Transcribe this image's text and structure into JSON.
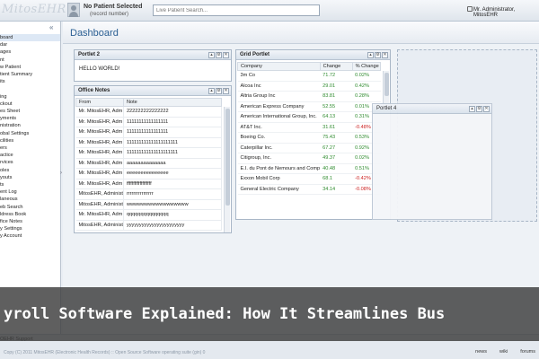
{
  "header": {
    "logo": "MitosEHR",
    "patient_name": "No Patient Selected",
    "patient_record": "(record number)",
    "search_placeholder": "Live Patient Search...",
    "user": "Mr. Administrator, MitosEHR"
  },
  "nav": {
    "collapse_glyph": "«",
    "items": [
      "board",
      "dar",
      "ages",
      "nt",
      "w Patient",
      "tient Summary",
      "its",
      "",
      "ing",
      "ckout",
      "es Sheet",
      "yments",
      "nistration",
      "obal Settings",
      "cilities",
      "ers",
      "actice",
      "rvices",
      "oles",
      "youts",
      "ts",
      "ent Log",
      "laneous",
      "eb Search",
      "ldress Book",
      "fice Notes",
      "y Settings",
      "y Account"
    ],
    "active_index": 0,
    "bottom": "OEHR Support"
  },
  "main": {
    "title": "Dashboard"
  },
  "portlet2": {
    "title": "Portlet 2",
    "body": "HELLO WORLD!"
  },
  "office_notes": {
    "title": "Office Notes",
    "columns": [
      "From",
      "Note"
    ],
    "rows": [
      [
        "Mr. MitosEHR, Adm",
        "222222222222222"
      ],
      [
        "Mr. MitosEHR, Adm",
        "11111111111111111"
      ],
      [
        "Mr. MitosEHR, Adm",
        "11111111111111111"
      ],
      [
        "Mr. MitosEHR, Adm",
        "111111111111111111111"
      ],
      [
        "Mr. MitosEHR, Adm",
        "111111111111111111111"
      ],
      [
        "Mr. MitosEHR, Adm",
        "aaaaaaaaaaaaaa"
      ],
      [
        "Mr. MitosEHR, Adm",
        "eeeeeeeeeeeeeee"
      ],
      [
        "Mr. MitosEHR, Adm",
        "fffffffffffffffffff"
      ],
      [
        "MitosEHR, Administ",
        "rrrrrrrrrrrrrrrr"
      ],
      [
        "MitosEHR, Administ",
        "wwwwwwwwwwwwwwwww"
      ],
      [
        "Mr. MitosEHR, Adm",
        "qqqqqqqqqqqqqqq"
      ],
      [
        "MitosEHR, Administ",
        "yyyyyyyyyyyyyyyyyyyyyyy"
      ]
    ]
  },
  "grid": {
    "title": "Grid Portlet",
    "columns": [
      "Company",
      "Change",
      "% Change"
    ],
    "rows": [
      [
        "3m Co",
        "71.72",
        "0.02%"
      ],
      [
        "Alcoa Inc",
        "29.01",
        "0.42%"
      ],
      [
        "Altria Group Inc",
        "83.81",
        "0.28%"
      ],
      [
        "American Express Company",
        "52.55",
        "0.01%"
      ],
      [
        "American International Group, Inc.",
        "64.13",
        "0.31%"
      ],
      [
        "AT&T Inc.",
        "31.61",
        "-0.48%"
      ],
      [
        "Boeing Co.",
        "75.43",
        "0.53%"
      ],
      [
        "Caterpillar Inc.",
        "67.27",
        "0.92%"
      ],
      [
        "Citigroup, Inc.",
        "49.37",
        "0.02%"
      ],
      [
        "E.I. du Pont de Nemours and Comp",
        "40.48",
        "0.51%"
      ],
      [
        "Exxon Mobil Corp",
        "68.1",
        "-0.42%"
      ],
      [
        "General Electric Company",
        "34.14",
        "-0.08%"
      ]
    ],
    "pos_color": "#2e8b2e",
    "neg_color": "#cc2222"
  },
  "portlet4": {
    "title": "Portlet 4"
  },
  "footer": {
    "copyright": "Copy (C) 2011 MitosEHR (Electronic Health Records) :: Open Source Software operating suite (gin) 0",
    "links": [
      "news",
      "wiki",
      "forums"
    ]
  },
  "banner": {
    "text": "yroll Software Explained: How It Streamlines Bus"
  }
}
